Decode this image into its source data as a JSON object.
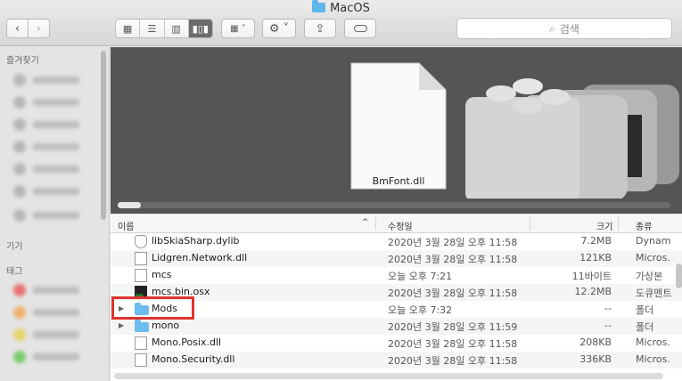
{
  "window": {
    "title": "MacOS"
  },
  "search": {
    "placeholder": "검색"
  },
  "sidebar": {
    "favorites_header": "즐겨찾기",
    "devices_header": "기기",
    "tags_header": "태그"
  },
  "preview": {
    "filename": "BmFont.dll"
  },
  "columns": {
    "name": "이름",
    "date": "수정일",
    "size": "크기",
    "kind": "종류"
  },
  "files": [
    {
      "name": "libSkiaSharp.dylib",
      "date": "2020년 3월 28일 오후 11:58",
      "size": "7.2MB",
      "kind": "Dynam",
      "icon": "shield-file-icon"
    },
    {
      "name": "Lidgren.Network.dll",
      "date": "2020년 3월 28일 오후 11:58",
      "size": "121KB",
      "kind": "Micros.",
      "icon": "file-icon"
    },
    {
      "name": "mcs",
      "date": "오늘 오후 7:21",
      "size": "11바이트",
      "kind": "가상본",
      "icon": "file-icon"
    },
    {
      "name": "mcs.bin.osx",
      "date": "2020년 3월 28일 오후 11:58",
      "size": "12.2MB",
      "kind": "도큐멘트",
      "icon": "exec-icon"
    },
    {
      "name": "Mods",
      "date": "오늘 오후 7:32",
      "size": "--",
      "kind": "폴더",
      "icon": "folder-icon"
    },
    {
      "name": "mono",
      "date": "2020년 3월 28일 오후 11:59",
      "size": "--",
      "kind": "폴더",
      "icon": "folder-icon"
    },
    {
      "name": "Mono.Posix.dll",
      "date": "2020년 3월 28일 오후 11:58",
      "size": "208KB",
      "kind": "Micros.",
      "icon": "file-icon"
    },
    {
      "name": "Mono.Security.dll",
      "date": "2020년 3월 28일 오후 11:58",
      "size": "336KB",
      "kind": "Micros.",
      "icon": "file-icon"
    }
  ],
  "colors": {
    "folder": "#6cbcef",
    "highlight": "#e0332e",
    "cover_bg": "#555555"
  }
}
